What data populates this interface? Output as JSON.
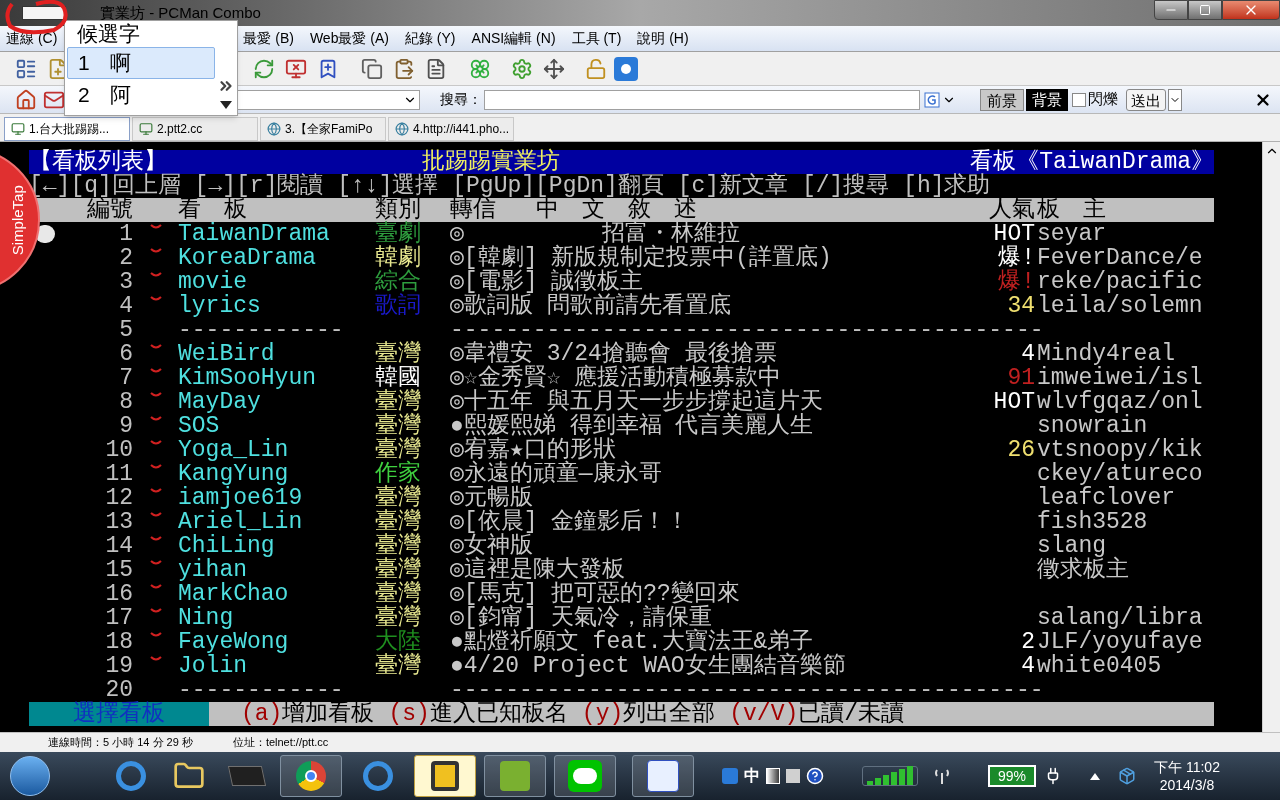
{
  "window": {
    "title": "實業坊 - PCMan Combo"
  },
  "menu": [
    "連線 (C)",
    "最愛 (B)",
    "Web最愛 (A)",
    "紀錄 (Y)",
    "ANSI編輯 (N)",
    "工具 (T)",
    "說明 (H)"
  ],
  "search_bar": {
    "label": "搜尋："
  },
  "color_buttons": [
    {
      "label": "前景",
      "selected": false
    },
    {
      "label": "背景",
      "selected": true
    }
  ],
  "blink": {
    "label": "閃爍",
    "checked": false
  },
  "send_button": "送出",
  "tabs": [
    {
      "label": "1.台大批踢踢...",
      "selected": true,
      "kind": "terminal"
    },
    {
      "label": "2.ptt2.cc",
      "selected": false,
      "kind": "terminal"
    },
    {
      "label": "3.【全家FamiPo",
      "selected": false,
      "kind": "web"
    },
    {
      "label": "4.http://i441.pho...",
      "selected": false,
      "kind": "web"
    }
  ],
  "ime": {
    "title": "候選字",
    "candidates": [
      {
        "index": "1",
        "char": "啊",
        "selected": true
      },
      {
        "index": "2",
        "char": "阿",
        "selected": false
      }
    ]
  },
  "overlay": {
    "label": "SimpleTap"
  },
  "terminal": {
    "header": {
      "left": "【看板列表】",
      "center": "批踢踢實業坊",
      "right": "看板《TaiwanDrama》"
    },
    "help": "[←][q]回上層 [→][r]閱讀 [↑↓]選擇 [PgUp][PgDn]翻頁 [c]新文章 [/]搜尋 [h]求助",
    "columns": [
      "編號",
      "看　板",
      "類別",
      "轉信",
      "中　文　敘　述",
      "人氣",
      "板　主"
    ],
    "rows": [
      {
        "kind": "board",
        "number": "1",
        "selected": true,
        "unread": true,
        "name": "TaiwanDrama",
        "category": {
          "text": "臺劇",
          "color": "#2e9e3e"
        },
        "title": "◎　　　　　　招富・林維拉",
        "pop": {
          "text": "HOT",
          "color": "#ffffff"
        },
        "moderator": "seyar"
      },
      {
        "kind": "board",
        "number": "2",
        "selected": false,
        "unread": true,
        "name": "KoreaDrama",
        "category": {
          "text": "韓劇",
          "color": "#e8e890"
        },
        "title": "◎[韓劇] 新版規制定投票中(詳置底)",
        "pop": {
          "text": "爆!",
          "color": "#ffffff"
        },
        "moderator": "FeverDance/e"
      },
      {
        "kind": "board",
        "number": "3",
        "selected": false,
        "unread": true,
        "name": "movie",
        "category": {
          "text": "綜合",
          "color": "#2e9e3e"
        },
        "title": "◎[電影] 誠徵板主",
        "pop": {
          "text": "爆!",
          "color": "#c02020"
        },
        "moderator": "reke/pacific"
      },
      {
        "kind": "board",
        "number": "4",
        "selected": false,
        "unread": true,
        "name": "lyrics",
        "category": {
          "text": "歌詞",
          "color": "#1a1acc"
        },
        "title": "◎歌詞版 問歌前請先看置底",
        "pop": {
          "text": "34",
          "color": "#f0e070"
        },
        "moderator": "leila/solemn"
      },
      {
        "kind": "separator",
        "number": "5",
        "selected": false,
        "unread": false,
        "name": "------------",
        "title": "-------------------------------------------"
      },
      {
        "kind": "board",
        "number": "6",
        "selected": false,
        "unread": true,
        "name": "WeiBird",
        "category": {
          "text": "臺灣",
          "color": "#e8e890"
        },
        "title": "◎韋禮安 3/24搶聽會 最後搶票",
        "pop": {
          "text": "4",
          "color": "#ffffff"
        },
        "moderator": "Mindy4real"
      },
      {
        "kind": "board",
        "number": "7",
        "selected": false,
        "unread": true,
        "name": "KimSooHyun",
        "category": {
          "text": "韓國",
          "color": "#ffffff"
        },
        "title": "◎☆金秀賢☆ 應援活動積極募款中",
        "pop": {
          "text": "91",
          "color": "#c02020"
        },
        "moderator": "imweiwei/isl"
      },
      {
        "kind": "board",
        "number": "8",
        "selected": false,
        "unread": true,
        "name": "MayDay",
        "category": {
          "text": "臺灣",
          "color": "#e8e890"
        },
        "title": "◎十五年 與五月天一步步撐起這片天",
        "pop": {
          "text": "HOT",
          "color": "#ffffff"
        },
        "moderator": "wlvfgqaz/onl"
      },
      {
        "kind": "board",
        "number": "9",
        "selected": false,
        "unread": true,
        "name": "SOS",
        "category": {
          "text": "臺灣",
          "color": "#e8e890"
        },
        "title": "●熙媛熙娣 得到幸福 代言美麗人生",
        "moderator": "snowrain"
      },
      {
        "kind": "board",
        "number": "10",
        "selected": false,
        "unread": true,
        "name": "Yoga_Lin",
        "category": {
          "text": "臺灣",
          "color": "#e8e890"
        },
        "title": "◎宥嘉★口的形狀",
        "pop": {
          "text": "26",
          "color": "#f0e070"
        },
        "moderator": "vtsnoopy/kik"
      },
      {
        "kind": "board",
        "number": "11",
        "selected": false,
        "unread": true,
        "name": "KangYung",
        "category": {
          "text": "作家",
          "color": "#3fcf3f"
        },
        "title": "◎永遠的頑童—康永哥",
        "moderator": "ckey/atureco"
      },
      {
        "kind": "board",
        "number": "12",
        "selected": false,
        "unread": true,
        "name": "iamjoe619",
        "category": {
          "text": "臺灣",
          "color": "#e8e890"
        },
        "title": "◎元暢版",
        "moderator": "leafclover"
      },
      {
        "kind": "board",
        "number": "13",
        "selected": false,
        "unread": true,
        "name": "Ariel_Lin",
        "category": {
          "text": "臺灣",
          "color": "#e8e890"
        },
        "title": "◎[依晨] 金鐘影后！！",
        "moderator": "fish3528"
      },
      {
        "kind": "board",
        "number": "14",
        "selected": false,
        "unread": true,
        "name": "ChiLing",
        "category": {
          "text": "臺灣",
          "color": "#e8e890"
        },
        "title": "◎女神版",
        "moderator": "slang"
      },
      {
        "kind": "board",
        "number": "15",
        "selected": false,
        "unread": true,
        "name": "yihan",
        "category": {
          "text": "臺灣",
          "color": "#e8e890"
        },
        "title": "◎這裡是陳大發板",
        "moderator": "徵求板主"
      },
      {
        "kind": "board",
        "number": "16",
        "selected": false,
        "unread": true,
        "name": "MarkChao",
        "category": {
          "text": "臺灣",
          "color": "#e8e890"
        },
        "title": "◎[馬克] 把可惡的??變回來"
      },
      {
        "kind": "board",
        "number": "17",
        "selected": false,
        "unread": true,
        "name": "Ning",
        "category": {
          "text": "臺灣",
          "color": "#e8e890"
        },
        "title": "◎[鈞甯] 天氣冷，請保重",
        "moderator": "salang/libra"
      },
      {
        "kind": "board",
        "number": "18",
        "selected": false,
        "unread": true,
        "name": "FayeWong",
        "category": {
          "text": "大陸",
          "color": "#1f8f1f"
        },
        "title": "●點燈祈願文 feat.大寶法王&弟子",
        "pop": {
          "text": "2",
          "color": "#ffffff"
        },
        "moderator": "JLF/yoyufaye"
      },
      {
        "kind": "board",
        "number": "19",
        "selected": false,
        "unread": true,
        "name": "Jolin",
        "category": {
          "text": "臺灣",
          "color": "#e8e890"
        },
        "title": "●4/20 Project WAO女生團結音樂節",
        "pop": {
          "text": "4",
          "color": "#ffffff"
        },
        "moderator": "white0405"
      },
      {
        "kind": "separator",
        "number": "20",
        "selected": false,
        "unread": false,
        "name": "------------",
        "title": "-------------------------------------------"
      }
    ],
    "footer": {
      "title": "選擇看板",
      "commands": [
        {
          "key": "(a)",
          "label": "增加看板"
        },
        {
          "key": "(s)",
          "label": "進入已知板名"
        },
        {
          "key": "(y)",
          "label": "列出全部"
        },
        {
          "key": "(v/V)",
          "label": "已讀/未讀"
        }
      ]
    }
  },
  "status_bar": {
    "connection_time": "連線時間：5 小時 14 分 29 秒",
    "address": "位址：telnet://ptt.cc"
  },
  "taskbar": {
    "ime_mode": "中",
    "battery": "99%",
    "time": "下午 11:02",
    "date": "2014/3/8"
  }
}
